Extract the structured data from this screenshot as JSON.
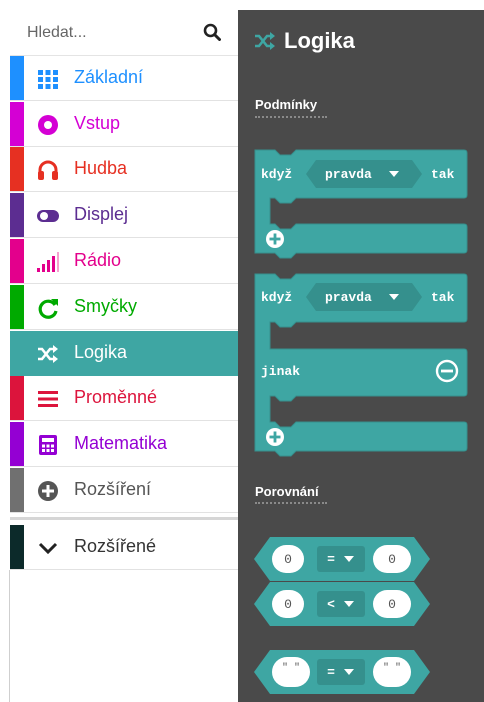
{
  "search": {
    "placeholder": "Hledat..."
  },
  "sidebar": {
    "categories": [
      {
        "label": "Základní",
        "color": "#1e90ff",
        "icon": "grid-icon"
      },
      {
        "label": "Vstup",
        "color": "#d400d4",
        "icon": "circle-dot-icon"
      },
      {
        "label": "Hudba",
        "color": "#e63022",
        "icon": "headphones-icon"
      },
      {
        "label": "Displej",
        "color": "#5c2d91",
        "icon": "toggle-icon"
      },
      {
        "label": "Rádio",
        "color": "#e3008c",
        "icon": "signal-bars-icon"
      },
      {
        "label": "Smyčky",
        "color": "#00aa00",
        "icon": "refresh-icon"
      },
      {
        "label": "Logika",
        "color": "#3ea6a3",
        "icon": "shuffle-icon"
      },
      {
        "label": "Proměnné",
        "color": "#dc143c",
        "icon": "list-lines-icon"
      },
      {
        "label": "Matematika",
        "color": "#9400d3",
        "icon": "calculator-icon"
      },
      {
        "label": "Rozšíření",
        "color": "#707070",
        "icon": "plus-circle-icon"
      }
    ],
    "advanced": {
      "label": "Rozšířené",
      "color": "#0c2a2a",
      "icon": "chevron-down-icon"
    }
  },
  "flyout": {
    "title": "Logika",
    "accent": "#3ea6a3",
    "section_conditions": "Podmínky",
    "section_comparison": "Porovnání",
    "if_keyword": "když",
    "then_keyword": "tak",
    "else_keyword": "jinak",
    "bool_value": "pravda",
    "compare_left": "0",
    "compare_right": "0",
    "op_equals": "=",
    "op_less": "<",
    "string_quotes": "\" \""
  }
}
